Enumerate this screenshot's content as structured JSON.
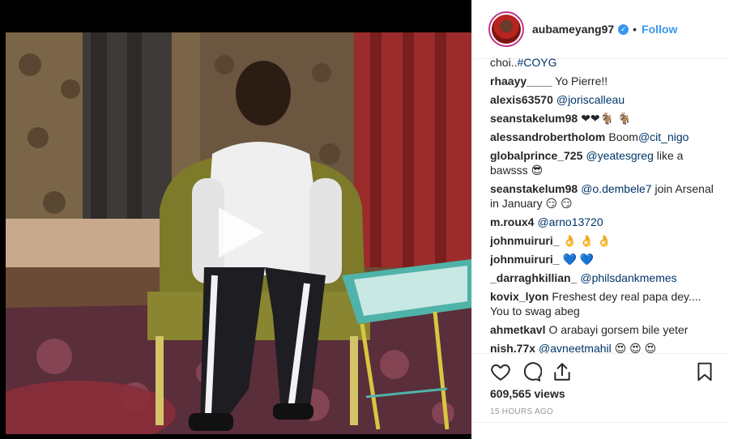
{
  "post": {
    "username": "aubameyang97",
    "verified_glyph": "✓",
    "separator": "•",
    "follow_label": "Follow"
  },
  "comments": [
    {
      "user": "",
      "text": "choi..",
      "mention": "#COYG"
    },
    {
      "user": "rhaayy____",
      "text": "Yo Pierre!!",
      "mention": ""
    },
    {
      "user": "alexis63570",
      "text": "",
      "mention": "@joriscalleau"
    },
    {
      "user": "seanstakelum98",
      "text": "❤❤🐐 🐐",
      "mention": ""
    },
    {
      "user": "alessandrobertholom",
      "text": "Boom",
      "mention": "@cit_nigo"
    },
    {
      "user": "globalprince_725",
      "text": "",
      "mention": "@yeatesgreg",
      "after": "like a bawsss 😎"
    },
    {
      "user": "seanstakelum98",
      "text": "",
      "mention": "@o.dembele7",
      "after": "join Arsenal in January 😏 😏"
    },
    {
      "user": "m.roux4",
      "text": "",
      "mention": "@arno13720"
    },
    {
      "user": "johnmuiruri_",
      "text": "👌 👌 👌",
      "mention": ""
    },
    {
      "user": "johnmuiruri_",
      "text": "💙 💙",
      "mention": ""
    },
    {
      "user": "_darraghkillian_",
      "text": "",
      "mention": "@philsdankmemes"
    },
    {
      "user": "kovix_lyon",
      "text": "Freshest dey real papa dey.... You to swag abeg",
      "mention": ""
    },
    {
      "user": "ahmetkavl",
      "text": "O arabayi gorsem bile yeter",
      "mention": ""
    },
    {
      "user": "nish.77x",
      "text": "",
      "mention": "@avneetmahil",
      "after": "😍 😍 😍"
    }
  ],
  "stats": {
    "views": "609,565 views",
    "time": "15 HOURS AGO"
  },
  "icons": {
    "like": "heart-icon",
    "comment": "comment-bubble-icon",
    "share": "share-icon",
    "save": "bookmark-icon",
    "play": "play-icon"
  },
  "colors": {
    "accent": "#3897f0",
    "mention": "#003569",
    "text": "#262626",
    "muted": "#999999"
  }
}
